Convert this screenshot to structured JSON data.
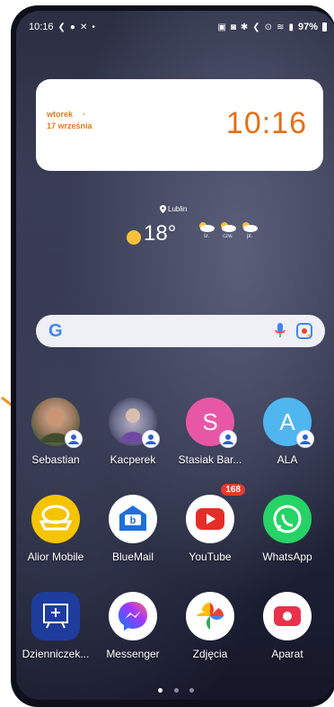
{
  "statusbar": {
    "time": "10:16",
    "battery": "97%",
    "left_icons": [
      "gesture-icon",
      "message-icon",
      "x-icon",
      "dot-icon"
    ],
    "right_icons": [
      "gallery-icon",
      "alarm-icon",
      "bluetooth-icon",
      "nfc-icon",
      "location-icon",
      "wifi-icon",
      "signal-icon"
    ]
  },
  "clock_widget": {
    "day": "wtorek",
    "date": "17 września",
    "time": "10:16",
    "accent": "#e36f18"
  },
  "weather": {
    "location": "Lublin",
    "temperature": "18°",
    "forecast": [
      {
        "label": "śr."
      },
      {
        "label": "czw."
      },
      {
        "label": "pt."
      }
    ]
  },
  "search": {
    "logo": "G",
    "icons": [
      "google-logo-icon",
      "mic-icon",
      "lens-icon"
    ]
  },
  "apps": [
    {
      "label": "Sebastian",
      "kind": "contact-photo",
      "badge": "user"
    },
    {
      "label": "Kacperek",
      "kind": "contact-photo",
      "badge": "user"
    },
    {
      "label": "Stasiak Bar...",
      "kind": "letter",
      "letter": "S",
      "color": "#e857a6",
      "badge": "user"
    },
    {
      "label": "ALA",
      "kind": "letter",
      "letter": "A",
      "color": "#4fb6f0",
      "badge": "user"
    },
    {
      "label": "Alior Mobile",
      "kind": "app",
      "color": "#f5c400"
    },
    {
      "label": "BlueMail",
      "kind": "app",
      "color": "#1e6fd9"
    },
    {
      "label": "YouTube",
      "kind": "app",
      "color": "#ffffff",
      "notification": "168"
    },
    {
      "label": "WhatsApp",
      "kind": "app",
      "color": "#25d366"
    },
    {
      "label": "Dzienniczek...",
      "kind": "app",
      "color": "#1d3c9c"
    },
    {
      "label": "Messenger",
      "kind": "app",
      "color": "#ffffff"
    },
    {
      "label": "Zdjęcia",
      "kind": "app",
      "color": "#ffffff"
    },
    {
      "label": "Aparat",
      "kind": "app",
      "color": "#ffffff"
    }
  ],
  "page_indicator": {
    "count": 3,
    "active": 1
  }
}
